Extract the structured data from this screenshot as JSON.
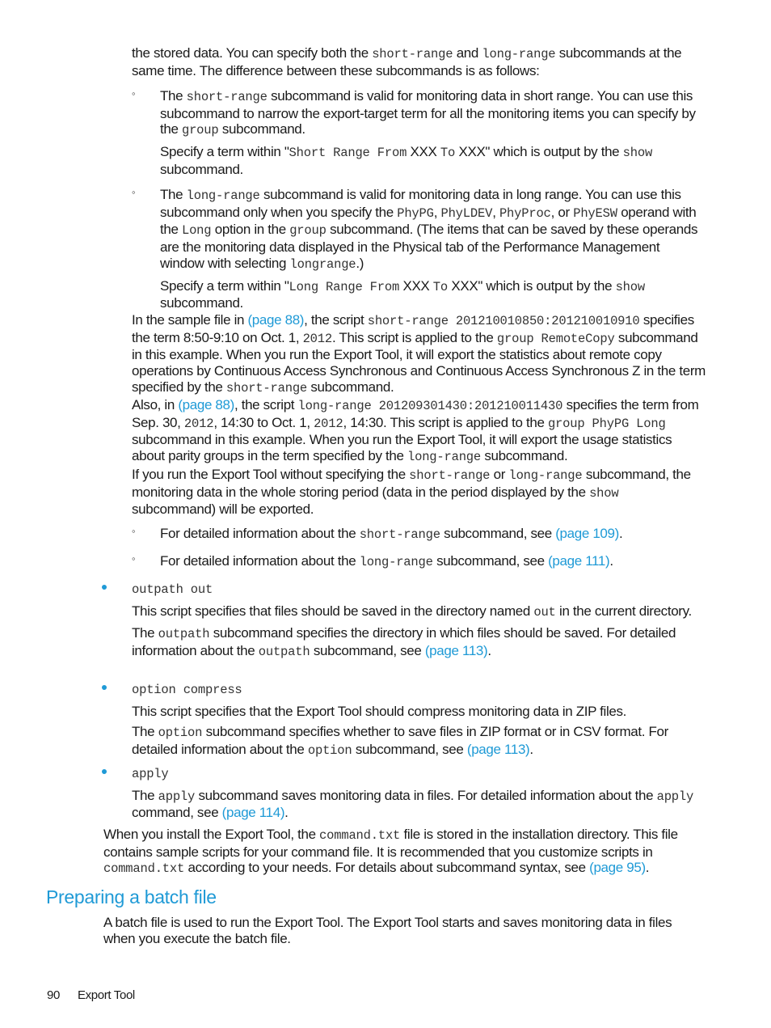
{
  "intro": {
    "t1": "the stored data. You can specify both the ",
    "c1": "short-range",
    "t2": " and ",
    "c2": "long-range",
    "t3": " subcommands at the same time. The difference between these subcommands is as follows:"
  },
  "short_item": {
    "marker": "◦",
    "p1": {
      "t1": "The ",
      "c1": "short-range",
      "t2": " subcommand is valid for monitoring data in short range. You can use this subcommand to narrow the export-target term for all the monitoring items you can specify by the ",
      "c2": "group",
      "t3": " subcommand."
    },
    "p2": {
      "t1": "Specify a term within \"",
      "c1": "Short Range From",
      "t2": " XXX ",
      "c2": "To",
      "t3": " XXX\" which is output by the ",
      "c3": "show",
      "t4": " subcommand."
    }
  },
  "long_item": {
    "marker": "◦",
    "p1": {
      "t1": "The ",
      "c1": "long-range",
      "t2": " subcommand is valid for monitoring data in long range. You can use this subcommand only when you specify the ",
      "c2": "PhyPG",
      "t3": ", ",
      "c3": "PhyLDEV",
      "t4": ", ",
      "c4": "PhyProc",
      "t5": ", or ",
      "c5": "PhyESW",
      "t6": " operand with the ",
      "c6": "Long",
      "t7": " option in the ",
      "c7": "group",
      "t8": " subcommand. (The items that can be saved by these operands are the monitoring data displayed in the Physical tab of the Performance Management window with selecting ",
      "c8": "longrange",
      "t9": ".)"
    },
    "p2": {
      "t1": "Specify a term within \"",
      "c1": "Long Range From",
      "t2": " XXX ",
      "c2": "To",
      "t3": " XXX\" which is output by the ",
      "c3": "show",
      "t4": " subcommand."
    }
  },
  "sample_para": {
    "t1": "In the sample file in ",
    "link": "(page 88)",
    "t2": ", the script ",
    "c1": "short-range 201210010850:201210010910",
    "t3": " specifies the term 8:50-9:10 on Oct. 1, ",
    "c2": "2012",
    "t4": ". This script is applied to the ",
    "c3": "group RemoteCopy",
    "t5": " subcommand in this example. When you run the Export Tool, it will export the statistics about remote copy operations by Continuous Access Synchronous and Continuous Access Synchronous Z in the term specified by the ",
    "c4": "short-range",
    "t6": " subcommand."
  },
  "also_para": {
    "t1": "Also, in ",
    "link": "(page 88)",
    "t2": ", the script ",
    "c1": "long-range 201209301430:201210011430",
    "t3": " specifies the term from Sep. 30, ",
    "c2": "2012",
    "t4": ", 14:30 to Oct. 1, ",
    "c3": "2012",
    "t5": ", 14:30. This script is applied to the ",
    "c4": "group PhyPG Long",
    "t6": " subcommand in this example. When you run the Export Tool, it will export the usage statistics about parity groups in the term specified by the ",
    "c5": "long-range",
    "t7": " subcommand."
  },
  "without_para": {
    "t1": "If you run the Export Tool without specifying the ",
    "c1": "short-range",
    "t2": " or ",
    "c2": "long-range",
    "t3": " subcommand, the monitoring data in the whole storing period (data in the period displayed by the ",
    "c3": "show",
    "t4": " subcommand) will be exported."
  },
  "ref_short": {
    "marker": "◦",
    "t1": "For detailed information about the ",
    "c1": "short-range",
    "t2": " subcommand, see ",
    "link": "(page 109)",
    "t3": "."
  },
  "ref_long": {
    "marker": "◦",
    "t1": "For detailed information about the ",
    "c1": "long-range",
    "t2": " subcommand, see ",
    "link": "(page 111)",
    "t3": "."
  },
  "outpath": {
    "code": "outpath out",
    "p1": {
      "t1": "This script specifies that files should be saved in the directory named ",
      "c1": "out",
      "t2": " in the current directory."
    },
    "p2": {
      "t1": "The ",
      "c1": "outpath",
      "t2": " subcommand specifies the directory in which files should be saved. For detailed information about the ",
      "c2": "outpath",
      "t3": " subcommand, see ",
      "link": "(page 113)",
      "t4": "."
    }
  },
  "option": {
    "code": "option compress",
    "p1": "This script specifies that the Export Tool should compress monitoring data in ZIP files.",
    "p2": {
      "t1": "The ",
      "c1": "option",
      "t2": " subcommand specifies whether to save files in ZIP format or in CSV format. For detailed information about the ",
      "c2": "option",
      "t3": " subcommand, see ",
      "link": "(page 113)",
      "t4": "."
    }
  },
  "apply": {
    "code": "apply",
    "p1": {
      "t1": "The ",
      "c1": "apply",
      "t2": " subcommand saves monitoring data in files. For detailed information about the ",
      "c2": "apply",
      "t3": " command, see ",
      "link": "(page 114)",
      "t4": "."
    }
  },
  "install_para": {
    "t1": "When you install the Export Tool, the ",
    "c1": "command.txt",
    "t2": " file is stored in the installation directory. This file contains sample scripts for your command file. It is recommended that you customize scripts in ",
    "c2": "command.txt",
    "t3": " according to your needs. For details about subcommand syntax, see ",
    "link": "(page 95)",
    "t4": "."
  },
  "section": {
    "heading": "Preparing a batch file",
    "body": "A batch file is used to run the Export Tool. The Export Tool starts and saves monitoring data in files when you execute the batch file."
  },
  "footer": {
    "page_number": "90",
    "title": "Export Tool"
  },
  "colors": {
    "accent": "#1f9ad6",
    "text": "#1a1a1a"
  }
}
